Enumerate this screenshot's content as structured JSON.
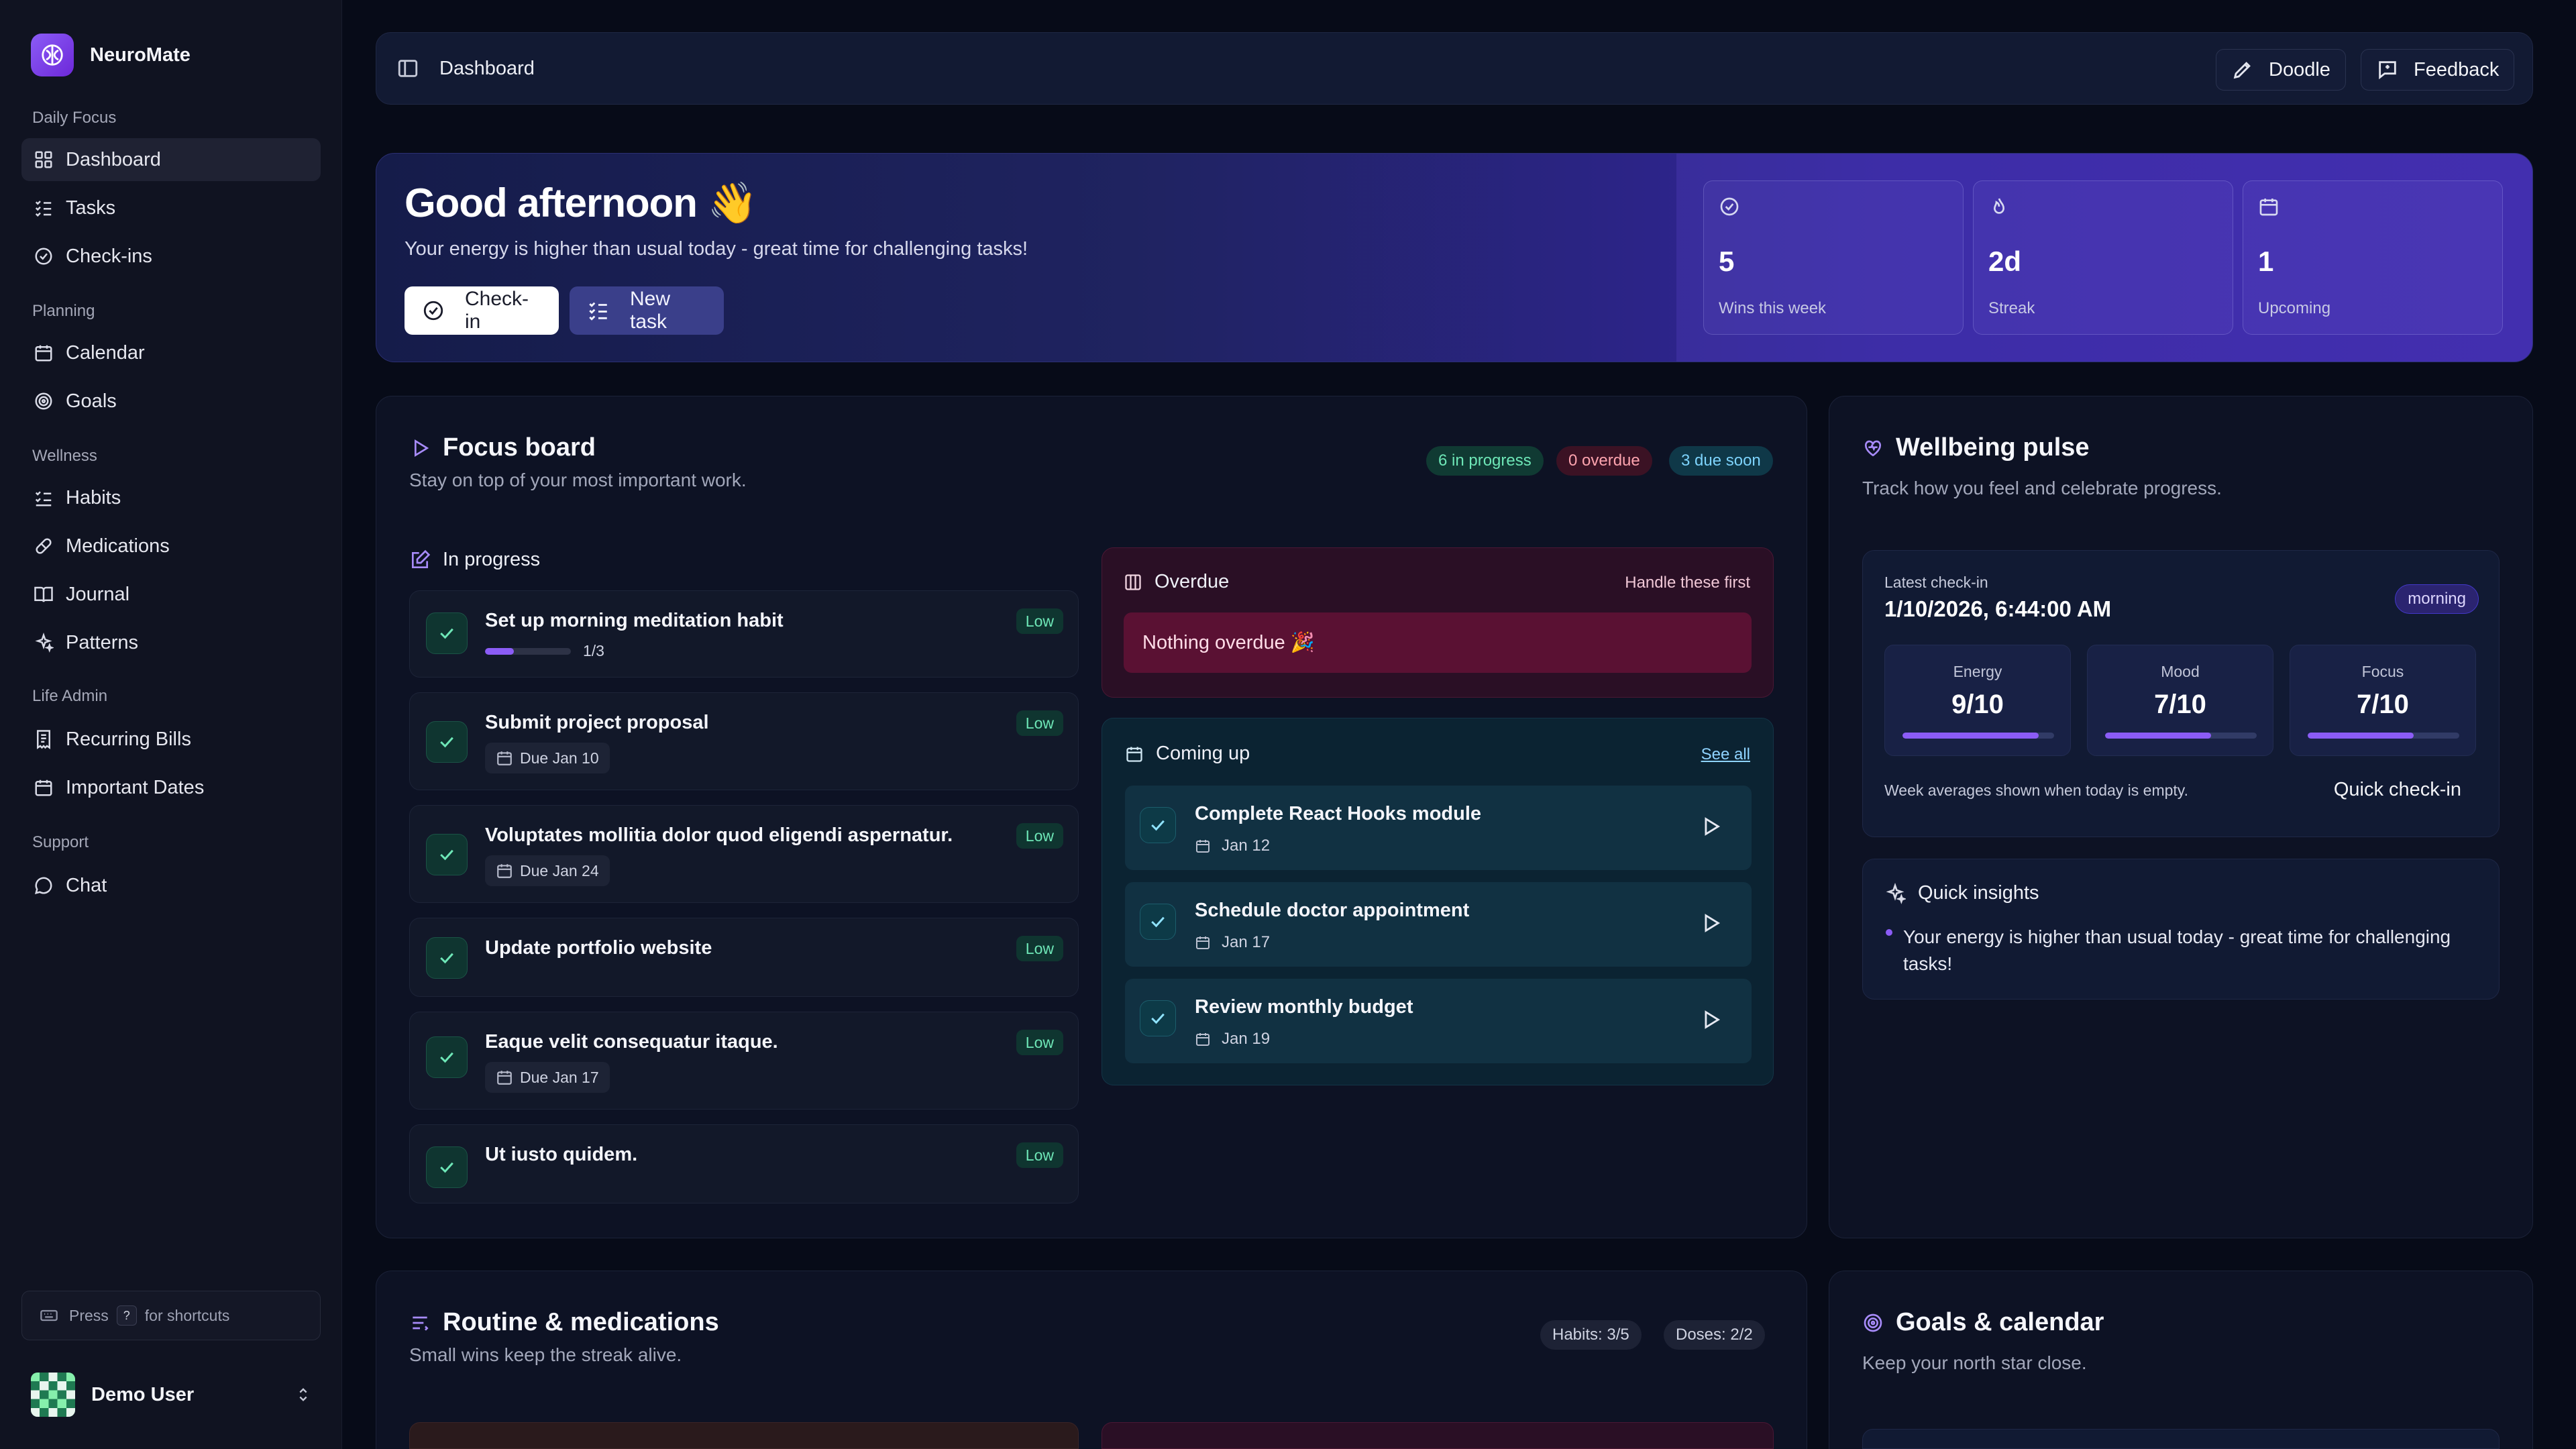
{
  "app": {
    "name": "NeuroMate"
  },
  "sidebar": {
    "groups": [
      {
        "label": "Daily Focus",
        "items": [
          {
            "label": "Dashboard",
            "icon": "dashboard-grid-icon",
            "active": true
          },
          {
            "label": "Tasks",
            "icon": "tasks-list-icon"
          },
          {
            "label": "Check-ins",
            "icon": "check-circle-icon"
          }
        ]
      },
      {
        "label": "Planning",
        "items": [
          {
            "label": "Calendar",
            "icon": "calendar-icon"
          },
          {
            "label": "Goals",
            "icon": "target-icon"
          }
        ]
      },
      {
        "label": "Wellness",
        "items": [
          {
            "label": "Habits",
            "icon": "habits-list-icon"
          },
          {
            "label": "Medications",
            "icon": "pill-icon"
          },
          {
            "label": "Journal",
            "icon": "book-icon"
          },
          {
            "label": "Patterns",
            "icon": "sparkles-icon"
          }
        ]
      },
      {
        "label": "Life Admin",
        "items": [
          {
            "label": "Recurring Bills",
            "icon": "receipt-icon"
          },
          {
            "label": "Important Dates",
            "icon": "calendar-icon"
          }
        ]
      },
      {
        "label": "Support",
        "items": [
          {
            "label": "Chat",
            "icon": "chat-bubble-icon"
          }
        ]
      }
    ],
    "shortcut": {
      "before": "Press",
      "key": "?",
      "after": "for shortcuts"
    },
    "user": {
      "name": "Demo User"
    }
  },
  "topbar": {
    "breadcrumb": "Dashboard",
    "doodle_label": "Doodle",
    "feedback_label": "Feedback"
  },
  "hero": {
    "title": "Good afternoon 👋",
    "subtitle": "Your energy is higher than usual today - great time for challenging tasks!",
    "checkin_label": "Check-in",
    "new_task_label": "New task",
    "stats": [
      {
        "value": "5",
        "label": "Wins this week",
        "icon": "check-circle-icon"
      },
      {
        "value": "2d",
        "label": "Streak",
        "icon": "flame-icon"
      },
      {
        "value": "1",
        "label": "Upcoming",
        "icon": "calendar-icon"
      }
    ]
  },
  "focus_board": {
    "title": "Focus board",
    "subtitle": "Stay on top of your most important work.",
    "badges": {
      "in_progress": "6 in progress",
      "overdue": "0 overdue",
      "due_soon": "3 due soon"
    },
    "in_progress_label": "In progress",
    "tasks": [
      {
        "title": "Set up morning meditation habit",
        "priority": "Low",
        "progress_text": "1/3",
        "progress": 0.3333
      },
      {
        "title": "Submit project proposal",
        "priority": "Low",
        "due": "Due Jan 10"
      },
      {
        "title": "Voluptates mollitia dolor quod eligendi aspernatur.",
        "priority": "Low",
        "due": "Due Jan 24"
      },
      {
        "title": "Update portfolio website",
        "priority": "Low"
      },
      {
        "title": "Eaque velit consequatur itaque.",
        "priority": "Low",
        "due": "Due Jan 17"
      },
      {
        "title": "Ut iusto quidem.",
        "priority": "Low"
      }
    ],
    "overdue": {
      "title": "Overdue",
      "hint": "Handle these first",
      "empty": "Nothing overdue 🎉"
    },
    "coming_up": {
      "title": "Coming up",
      "see_all": "See all",
      "items": [
        {
          "title": "Complete React Hooks module",
          "date": "Jan 12"
        },
        {
          "title": "Schedule doctor appointment",
          "date": "Jan 17"
        },
        {
          "title": "Review monthly budget",
          "date": "Jan 19"
        }
      ]
    }
  },
  "wellbeing": {
    "title": "Wellbeing pulse",
    "subtitle": "Track how you feel and celebrate progress.",
    "latest_label": "Latest check-in",
    "latest_value": "1/10/2026, 6:44:00 AM",
    "period_badge": "morning",
    "metrics": [
      {
        "label": "Energy",
        "value": "9/10",
        "level": 0.9
      },
      {
        "label": "Mood",
        "value": "7/10",
        "level": 0.7
      },
      {
        "label": "Focus",
        "value": "7/10",
        "level": 0.7
      }
    ],
    "note": "Week averages shown when today is empty.",
    "quick_checkin": "Quick check-in",
    "insights_title": "Quick insights",
    "insight_line1": "Your energy is higher than usual today - great time for challenging",
    "insight_line2": "tasks!"
  },
  "routine": {
    "title": "Routine & medications",
    "subtitle": "Small wins keep the streak alive.",
    "habits_badge": "Habits: 3/5",
    "doses_badge": "Doses: 2/2"
  },
  "goals": {
    "title": "Goals & calendar",
    "subtitle": "Keep your north star close."
  },
  "colors": {
    "accent": "#8b5cf6",
    "success": "#6ee7b7",
    "danger": "#fda4af",
    "info": "#7dd3fc"
  }
}
